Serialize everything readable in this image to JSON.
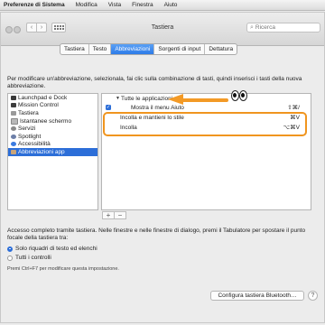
{
  "menubar": {
    "app_name": "Preferenze di Sistema",
    "items": [
      "Modifica",
      "Vista",
      "Finestra",
      "Aiuto"
    ]
  },
  "window": {
    "title": "Tastiera",
    "nav_back_icon": "chevron-left-icon",
    "nav_forward_icon": "chevron-right-icon",
    "search_placeholder": "Ricerca"
  },
  "tabs": [
    {
      "label": "Tastiera",
      "active": false
    },
    {
      "label": "Testo",
      "active": false
    },
    {
      "label": "Abbreviazioni",
      "active": true
    },
    {
      "label": "Sorgenti di input",
      "active": false
    },
    {
      "label": "Dettatura",
      "active": false
    }
  ],
  "description": "Per modificare un'abbreviazione, selezionala, fai clic sulla combinazione di tasti, quindi inserisci i tasti della nuova abbreviazione.",
  "categories": [
    {
      "label": "Launchpad e Dock",
      "icon": "launchpad-icon",
      "icon_color": "#3a3a3a"
    },
    {
      "label": "Mission Control",
      "icon": "mission-control-icon",
      "icon_color": "#3d3d3d"
    },
    {
      "label": "Tastiera",
      "icon": "keyboard-icon",
      "icon_color": "#9a9a9a"
    },
    {
      "label": "Istantanee schermo",
      "icon": "screenshot-icon",
      "icon_color": "#b8b8b8"
    },
    {
      "label": "Servizi",
      "icon": "gear-icon",
      "icon_color": "#8a8a8a"
    },
    {
      "label": "Spotlight",
      "icon": "spotlight-icon",
      "icon_color": "#6d7fa8"
    },
    {
      "label": "Accessibilità",
      "icon": "accessibility-icon",
      "icon_color": "#3b7be0"
    },
    {
      "label": "Abbreviazioni app",
      "icon": "app-shortcuts-icon",
      "icon_color": "#c9a47a",
      "selected": true
    }
  ],
  "shortcuts": {
    "group_label": "Tutte le applicazioni",
    "rows": [
      {
        "label": "Mostra il menu Aiuto",
        "key": "⇧⌘/",
        "checked": true
      },
      {
        "label": "Incolla e mantieni lo stile",
        "key": "⌘V"
      },
      {
        "label": "Incolla",
        "key": "⌥⌘V"
      }
    ]
  },
  "list_buttons": {
    "add": "+",
    "remove": "−"
  },
  "access_description": "Accesso completo tramite tastiera. Nelle finestre e nelle finestre di dialogo, premi il Tabulatore per spostare il punto focale della tastiera tra:",
  "radio_options": [
    {
      "label": "Solo riquadri di testo ed elenchi",
      "selected": true
    },
    {
      "label": "Tutti i controlli",
      "selected": false
    }
  ],
  "hint": "Premi Ctrl+F7 per modificare questa impostazione.",
  "configure_button": "Configura tastiera Bluetooth…",
  "help_button": "?",
  "colors": {
    "accent": "#2c6ed8",
    "annotation_orange": "#f0951f"
  }
}
